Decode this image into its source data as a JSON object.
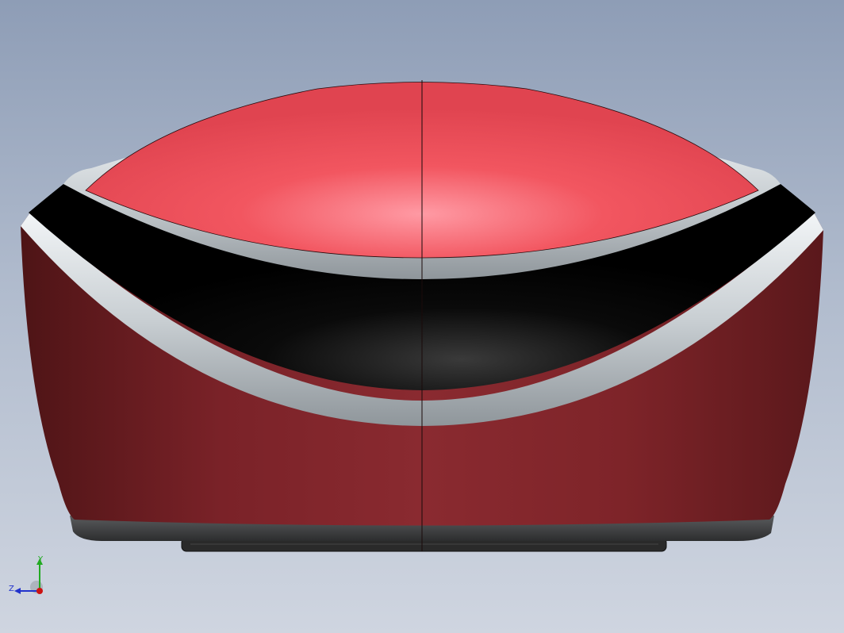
{
  "viewport": {
    "background_top": "#8e9db6",
    "background_bottom": "#cfd5e0"
  },
  "model": {
    "colors": {
      "red_top": "#e84a54",
      "red_highlight": "#ff9aa4",
      "red_body": "#8a2a30",
      "red_body_dark": "#4e1416",
      "black_band": "#050505",
      "silver": "#d8dde0",
      "base": "#3a3a3a"
    }
  },
  "triad": {
    "y_label": "Y",
    "z_label": "Z",
    "y_color": "#22aa22",
    "z_color": "#2233cc",
    "x_color": "#cc1111"
  }
}
